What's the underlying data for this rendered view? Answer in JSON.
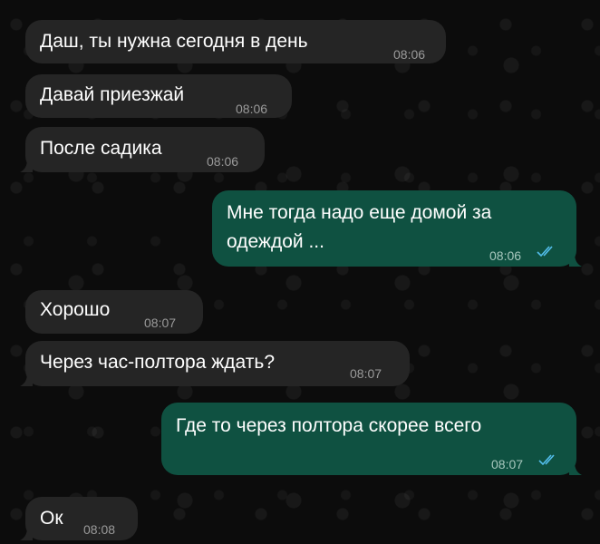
{
  "chat": {
    "messages": [
      {
        "dir": "in",
        "text": "Даш, ты нужна сегодня в день",
        "time": "08:06"
      },
      {
        "dir": "in",
        "text": "Давай приезжай",
        "time": "08:06"
      },
      {
        "dir": "in",
        "text": "После садика",
        "time": "08:06"
      },
      {
        "dir": "out",
        "text_line1": "Мне тогда надо еще домой за",
        "text_line2": "одеждой ...",
        "time": "08:06",
        "status": "read"
      },
      {
        "dir": "in",
        "text": "Хорошо",
        "time": "08:07"
      },
      {
        "dir": "in",
        "text": "Через час-полтора ждать?",
        "time": "08:07"
      },
      {
        "dir": "out",
        "text": "Где то через полтора скорее всего",
        "time": "08:07",
        "status": "read"
      },
      {
        "dir": "in",
        "text": "Ок",
        "time": "08:08"
      }
    ]
  },
  "colors": {
    "incoming_bubble": "#252525",
    "outgoing_bubble": "#0f5141",
    "read_ticks": "#53bdeb"
  },
  "icons": {
    "read_status": "double-check-icon"
  }
}
